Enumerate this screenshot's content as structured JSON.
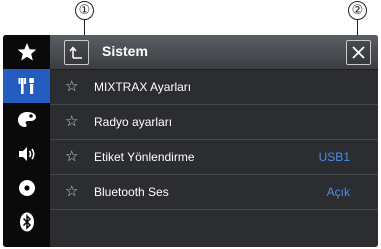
{
  "callouts": {
    "left": "①",
    "right": "②"
  },
  "header": {
    "title": "Sistem"
  },
  "sidebar": {
    "items": [
      {
        "name": "favorites"
      },
      {
        "name": "settings",
        "active": true
      },
      {
        "name": "theme"
      },
      {
        "name": "audio"
      },
      {
        "name": "source"
      },
      {
        "name": "bluetooth"
      }
    ]
  },
  "rows": [
    {
      "label": "MIXTRAX Ayarları",
      "value": ""
    },
    {
      "label": "Radyo ayarları",
      "value": ""
    },
    {
      "label": "Etiket Yönlendirme",
      "value": "USB1"
    },
    {
      "label": "Bluetooth Ses",
      "value": "Açık"
    }
  ],
  "colors": {
    "active": "#245cc0",
    "value": "#4a8fe8",
    "panel": "#2b2d31"
  }
}
